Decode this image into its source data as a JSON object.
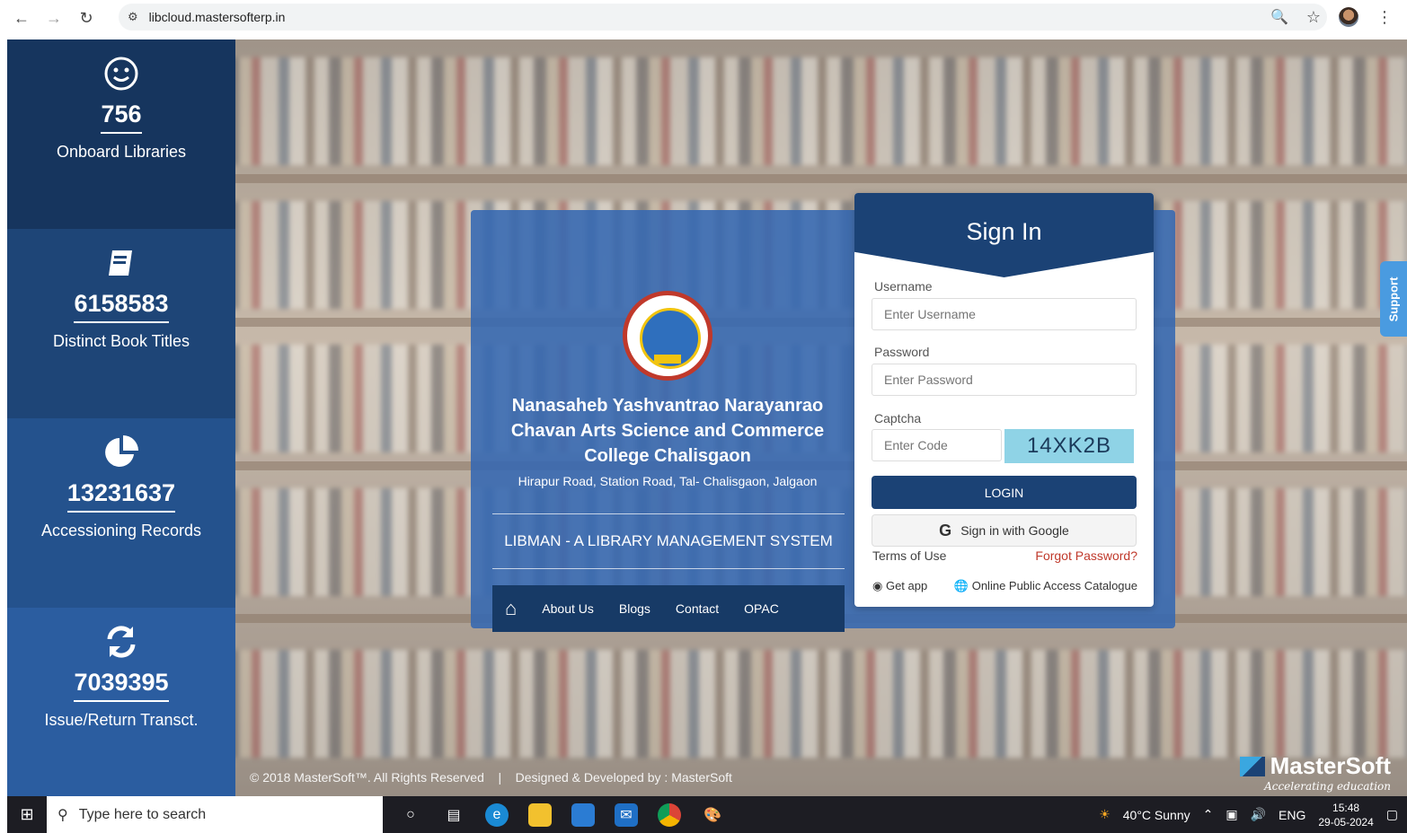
{
  "browser": {
    "url": "libcloud.mastersofterp.in",
    "icons": [
      "back-icon",
      "forward-icon",
      "reload-icon",
      "site-settings-icon",
      "zoom-icon",
      "bookmark-star-icon",
      "profile-avatar",
      "menu-icon"
    ]
  },
  "stats": [
    {
      "icon": "smile-icon",
      "value": "756",
      "label": "Onboard Libraries",
      "color": "#16355e"
    },
    {
      "icon": "book-icon",
      "value": "6158583",
      "label": "Distinct Book Titles",
      "color": "#1e4577"
    },
    {
      "icon": "pie-chart-icon",
      "value": "13231637",
      "label": "Accessioning Records",
      "color": "#24528d"
    },
    {
      "icon": "refresh-icon",
      "value": "7039395",
      "label": "Issue/Return Transct.",
      "color": "#2b5da0"
    }
  ],
  "college": {
    "name": "Nanasaheb Yashvantrao Narayanrao Chavan Arts Science and Commerce College Chalisgaon",
    "address": "Hirapur Road, Station Road, Tal- Chalisgaon, Jalgaon",
    "system_title": "LIBMAN - A LIBRARY MANAGEMENT SYSTEM"
  },
  "nav": {
    "items": [
      "About Us",
      "Blogs",
      "Contact",
      "OPAC"
    ]
  },
  "signin": {
    "title": "Sign In",
    "username_label": "Username",
    "username_placeholder": "Enter Username",
    "password_label": "Password",
    "password_placeholder": "Enter Password",
    "captcha_label": "Captcha",
    "captcha_placeholder": "Enter Code",
    "captcha_code": "14XK2B",
    "login_label": "LOGIN",
    "google_label": "Sign in with Google",
    "terms": "Terms of Use",
    "forgot": "Forgot Password?",
    "get_app": "Get app",
    "opac": "Online Public Access Catalogue"
  },
  "support": "Support",
  "footer": {
    "copyright": "© 2018 MasterSoft™. All Rights Reserved",
    "separator": "|",
    "developed": "Designed & Developed by : MasterSoft",
    "brand": "MasterSoft",
    "tagline": "Accelerating education"
  },
  "taskbar": {
    "search_placeholder": "Type here to search",
    "weather": "40°C  Sunny",
    "lang": "ENG",
    "time": "15:48",
    "date": "29-05-2024"
  }
}
